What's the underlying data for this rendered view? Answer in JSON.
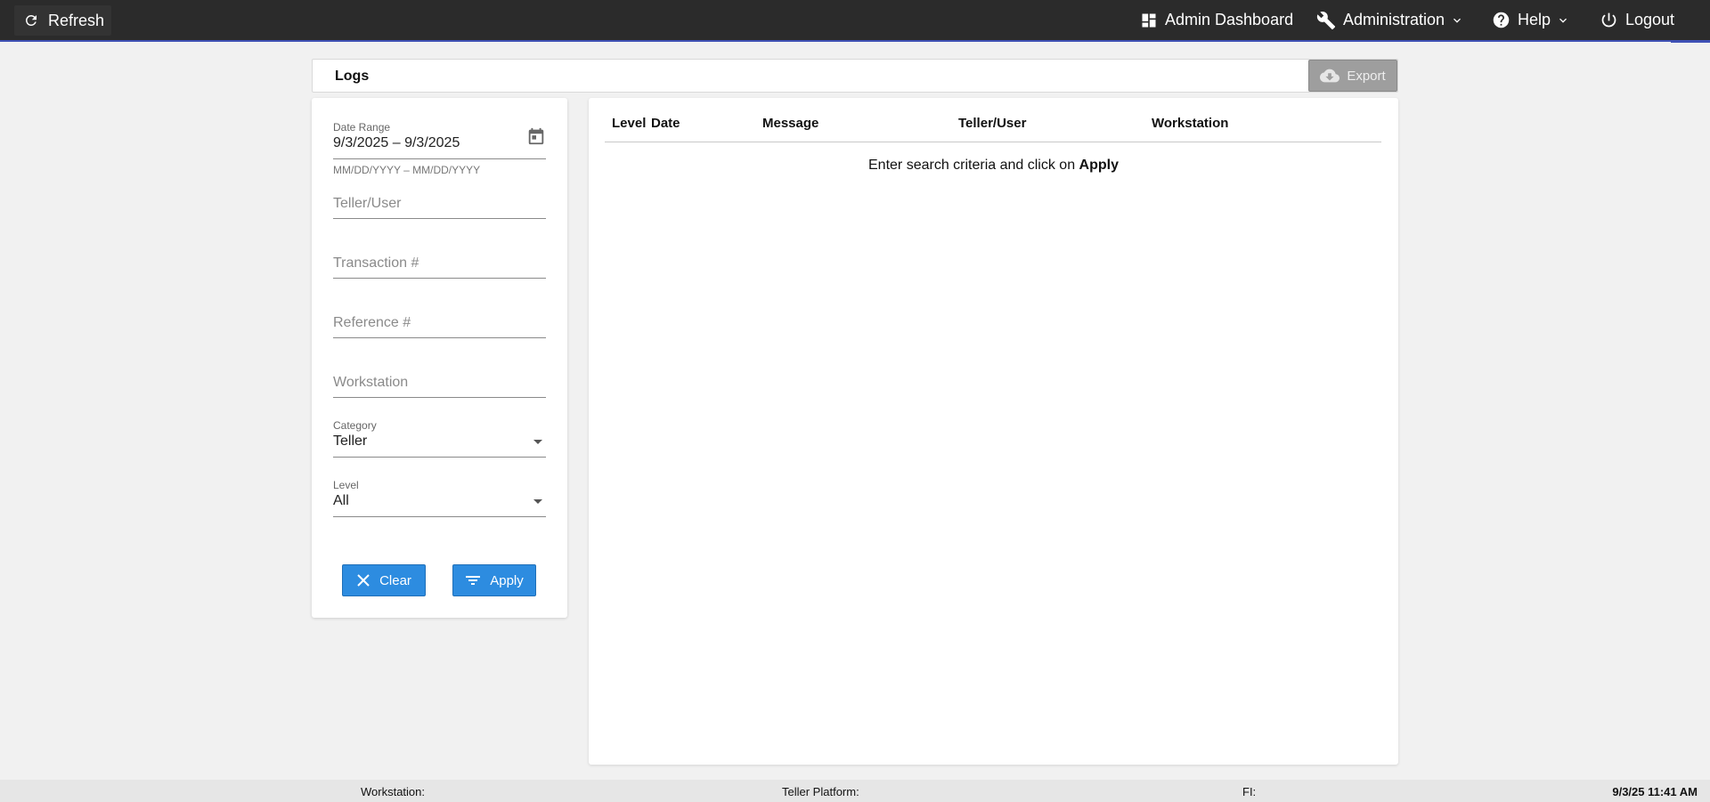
{
  "topbar": {
    "refresh_label": "Refresh",
    "admin_dashboard_label": "Admin Dashboard",
    "administration_label": "Administration",
    "help_label": "Help",
    "logout_label": "Logout"
  },
  "logs": {
    "title": "Logs",
    "export_label": "Export"
  },
  "filters": {
    "date_range_label": "Date Range",
    "date_range_value": "9/3/2025 – 9/3/2025",
    "date_range_hint": "MM/DD/YYYY – MM/DD/YYYY",
    "teller_user_placeholder": "Teller/User",
    "transaction_placeholder": "Transaction #",
    "reference_placeholder": "Reference #",
    "workstation_placeholder": "Workstation",
    "category_label": "Category",
    "category_value": "Teller",
    "level_label": "Level",
    "level_value": "All",
    "clear_label": "Clear",
    "apply_label": "Apply"
  },
  "results": {
    "columns": [
      "Level",
      "Date",
      "Message",
      "Teller/User",
      "Workstation"
    ],
    "empty_prefix": "Enter search criteria and click on ",
    "empty_action": "Apply"
  },
  "statusbar": {
    "workstation_label": "Workstation:",
    "platform_label": "Teller Platform:",
    "fi_label": "FI:",
    "datetime": "9/3/25 11:41 AM"
  },
  "colors": {
    "topbar_bg": "#2b2b2b",
    "accent_underline": "#3f51b5",
    "primary_button": "#2d8ce0",
    "export_disabled": "#9e9e9e",
    "page_bg": "#f1f1f1"
  },
  "icons": {
    "refresh": "refresh-icon",
    "dashboard": "dashboard-icon",
    "wrench": "wrench-icon",
    "help": "help-circle-icon",
    "power": "power-icon",
    "cloud_download": "cloud-download-icon",
    "calendar": "calendar-icon",
    "close": "close-icon",
    "filter": "filter-icon"
  }
}
